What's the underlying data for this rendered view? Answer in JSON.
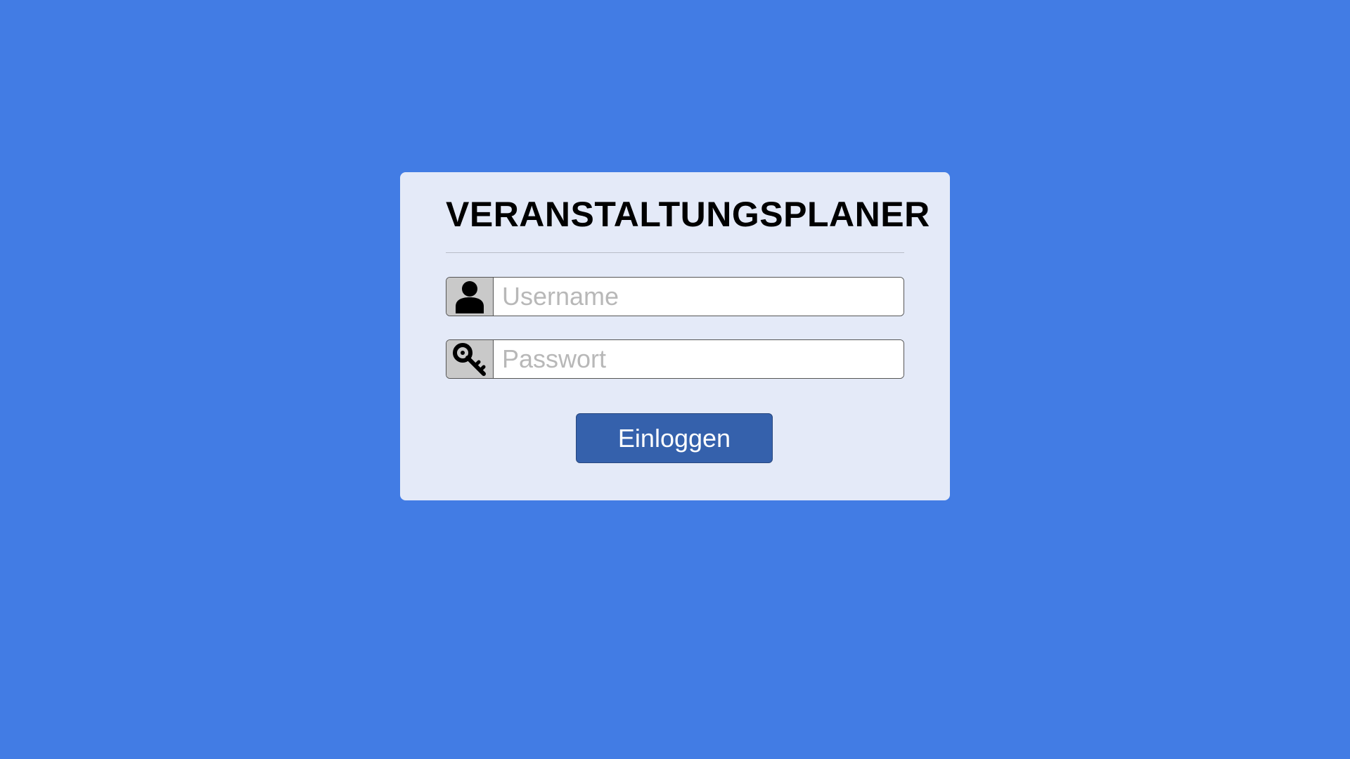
{
  "login_card": {
    "title": "VERANSTALTUNGSPLANER",
    "username": {
      "placeholder": "Username",
      "value": "",
      "icon": "user-icon"
    },
    "password": {
      "placeholder": "Passwort",
      "value": "",
      "icon": "key-icon"
    },
    "login_button_label": "Einloggen"
  },
  "colors": {
    "background": "#427ce4",
    "card": "#e4eaf8",
    "button": "#3561ac",
    "icon_box": "#c9c9c9"
  }
}
